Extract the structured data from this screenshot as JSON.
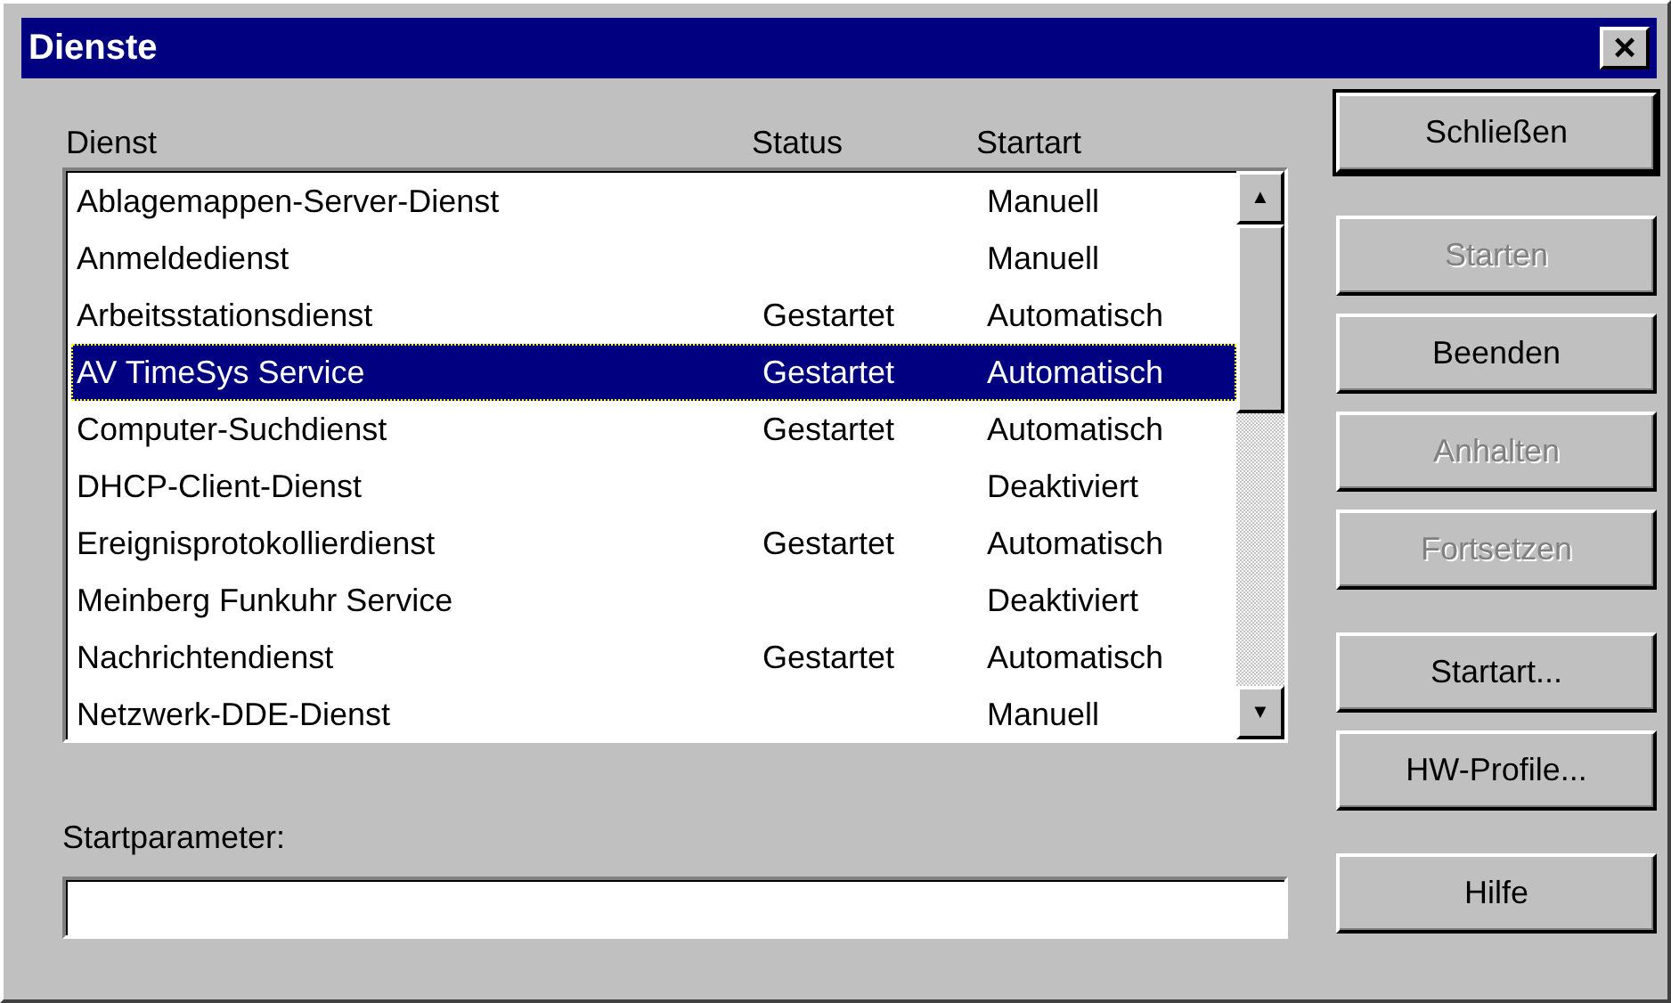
{
  "window": {
    "title": "Dienste",
    "close": "×"
  },
  "columns": [
    {
      "label": "Dienst"
    },
    {
      "label": "Status"
    },
    {
      "label": "Startart"
    }
  ],
  "rows": [
    {
      "name": "Ablagemappen-Server-Dienst",
      "status": "",
      "startart": "Manuell",
      "selected": false
    },
    {
      "name": "Anmeldedienst",
      "status": "",
      "startart": "Manuell",
      "selected": false
    },
    {
      "name": "Arbeitsstationsdienst",
      "status": "Gestartet",
      "startart": "Automatisch",
      "selected": false
    },
    {
      "name": "AV TimeSys Service",
      "status": "Gestartet",
      "startart": "Automatisch",
      "selected": true
    },
    {
      "name": "Computer-Suchdienst",
      "status": "Gestartet",
      "startart": "Automatisch",
      "selected": false
    },
    {
      "name": "DHCP-Client-Dienst",
      "status": "",
      "startart": "Deaktiviert",
      "selected": false
    },
    {
      "name": "Ereignisprotokollierdienst",
      "status": "Gestartet",
      "startart": "Automatisch",
      "selected": false
    },
    {
      "name": "Meinberg Funkuhr Service",
      "status": "",
      "startart": "Deaktiviert",
      "selected": false
    },
    {
      "name": "Nachrichtendienst",
      "status": "Gestartet",
      "startart": "Automatisch",
      "selected": false
    },
    {
      "name": "Netzwerk-DDE-Dienst",
      "status": "",
      "startart": "Manuell",
      "selected": false
    }
  ],
  "scrollbar": {
    "up": "▲",
    "down": "▼"
  },
  "startparameter": {
    "label": "Startparameter:"
  },
  "buttons": [
    {
      "label": "Schließen",
      "default": true,
      "disabled": false
    },
    {
      "label": "Starten",
      "default": false,
      "disabled": true
    },
    {
      "label": "Beenden",
      "default": false,
      "disabled": false
    },
    {
      "label": "Anhalten",
      "default": false,
      "disabled": true
    },
    {
      "label": "Fortsetzen",
      "default": false,
      "disabled": true
    },
    {
      "label": "Startart...",
      "default": false,
      "disabled": false
    },
    {
      "label": "HW-Profile...",
      "default": false,
      "disabled": false
    },
    {
      "label": "Hilfe",
      "default": false,
      "disabled": false
    }
  ]
}
